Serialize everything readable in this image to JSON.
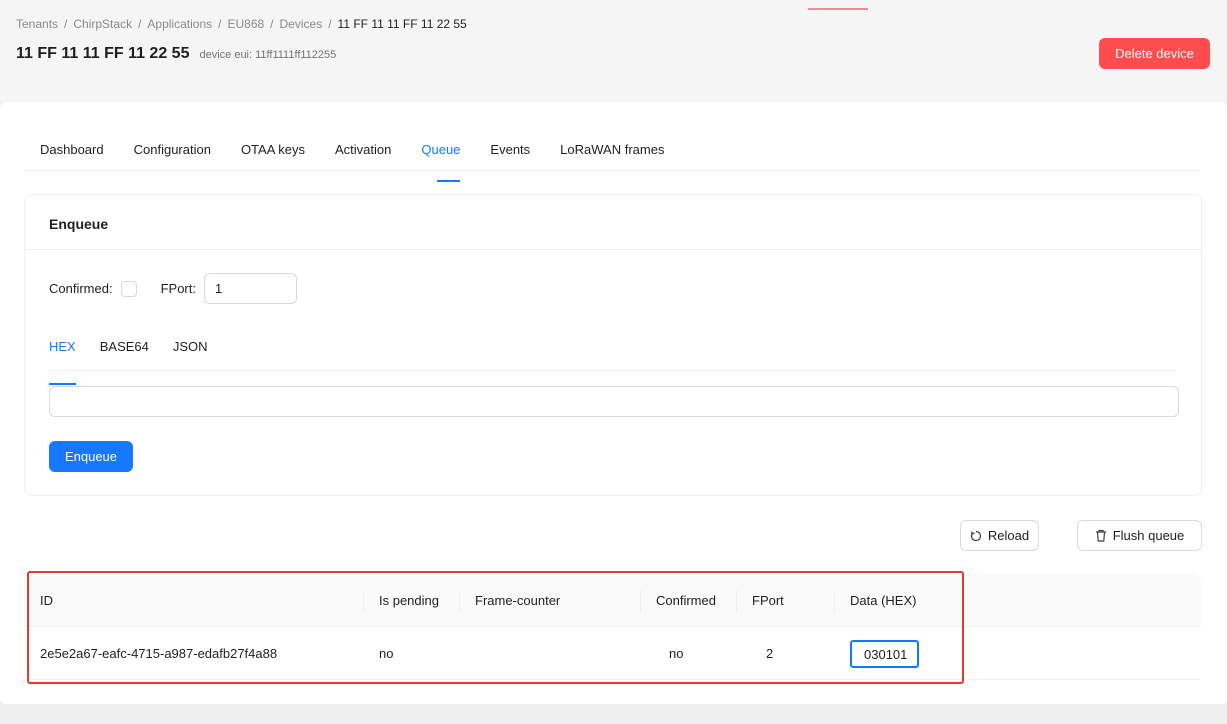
{
  "breadcrumb": {
    "items": [
      "Tenants",
      "ChirpStack",
      "Applications",
      "EU868",
      "Devices"
    ],
    "separator": "/",
    "current": "11 FF 11 11 FF 11 22 55"
  },
  "header": {
    "title": "11 FF 11 11 FF 11 22 55",
    "subtitle": "device eui: 11ff1111ff112255",
    "delete_label": "Delete device"
  },
  "tabs": [
    {
      "label": "Dashboard"
    },
    {
      "label": "Configuration"
    },
    {
      "label": "OTAA keys"
    },
    {
      "label": "Activation"
    },
    {
      "label": "Queue",
      "active": true
    },
    {
      "label": "Events"
    },
    {
      "label": "LoRaWAN frames"
    }
  ],
  "enqueue": {
    "title": "Enqueue",
    "confirmed_label": "Confirmed",
    "colon": ":",
    "fport_label": "FPort",
    "fport_value": "1",
    "subtabs": [
      {
        "label": "HEX",
        "active": true
      },
      {
        "label": "BASE64"
      },
      {
        "label": "JSON"
      }
    ],
    "payload_value": "",
    "submit_label": "Enqueue"
  },
  "actions": {
    "reload_label": "Reload",
    "flush_label": "Flush queue"
  },
  "table": {
    "columns": [
      "ID",
      "Is pending",
      "Frame-counter",
      "Confirmed",
      "FPort",
      "Data (HEX)"
    ],
    "rows": [
      {
        "id": "2e5e2a67-eafc-4715-a987-edafb27f4a88",
        "is_pending": "no",
        "frame_counter": "",
        "confirmed": "no",
        "fport": "2",
        "data_hex": "030101"
      }
    ]
  },
  "colors": {
    "primary": "#1677ff",
    "danger": "#ff4d4f",
    "highlight": "#e53935"
  }
}
